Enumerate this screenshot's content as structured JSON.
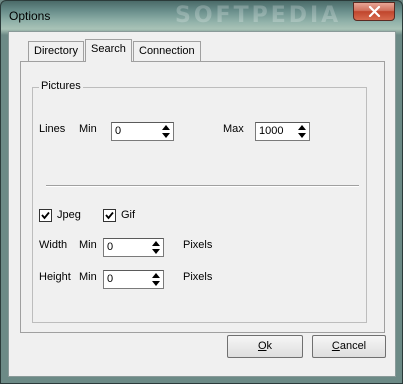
{
  "window": {
    "title": "Options",
    "watermark": "SOFTPEDIA",
    "close_icon": "close-icon"
  },
  "tabs": [
    {
      "label": "Directory",
      "active": false
    },
    {
      "label": "Search",
      "active": true
    },
    {
      "label": "Connection",
      "active": false
    }
  ],
  "pictures_group": {
    "legend": "Pictures",
    "lines": {
      "label": "Lines",
      "min_label": "Min",
      "min_value": "0",
      "max_label": "Max",
      "max_value": "1000"
    },
    "jpeg": {
      "label": "Jpeg",
      "checked": true
    },
    "gif": {
      "label": "Gif",
      "checked": true
    },
    "width": {
      "label": "Width",
      "min_label": "Min",
      "min_value": "0",
      "unit": "Pixels"
    },
    "height": {
      "label": "Height",
      "min_label": "Min",
      "min_value": "0",
      "unit": "Pixels"
    }
  },
  "buttons": {
    "ok": {
      "mnemonic": "O",
      "rest": "k"
    },
    "cancel": {
      "mnemonic": "C",
      "rest": "ancel"
    }
  }
}
